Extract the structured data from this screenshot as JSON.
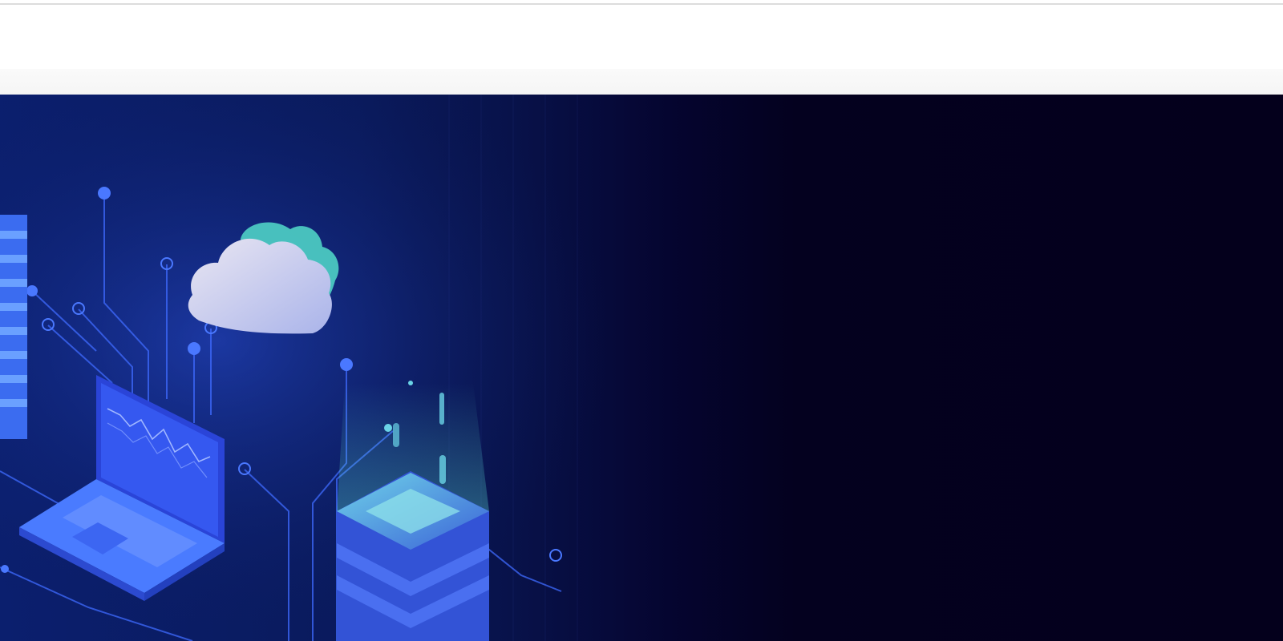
{
  "header": {
    "logo_text": "",
    "nav_items": []
  },
  "hero": {
    "illustration": "cloud-computing-illustration",
    "colors": {
      "banner_left": "#0b1f6e",
      "banner_right": "#04001c",
      "accent_blue": "#3f6bff",
      "accent_teal": "#4fd1c5",
      "cloud_light": "#dfe3f5"
    }
  }
}
